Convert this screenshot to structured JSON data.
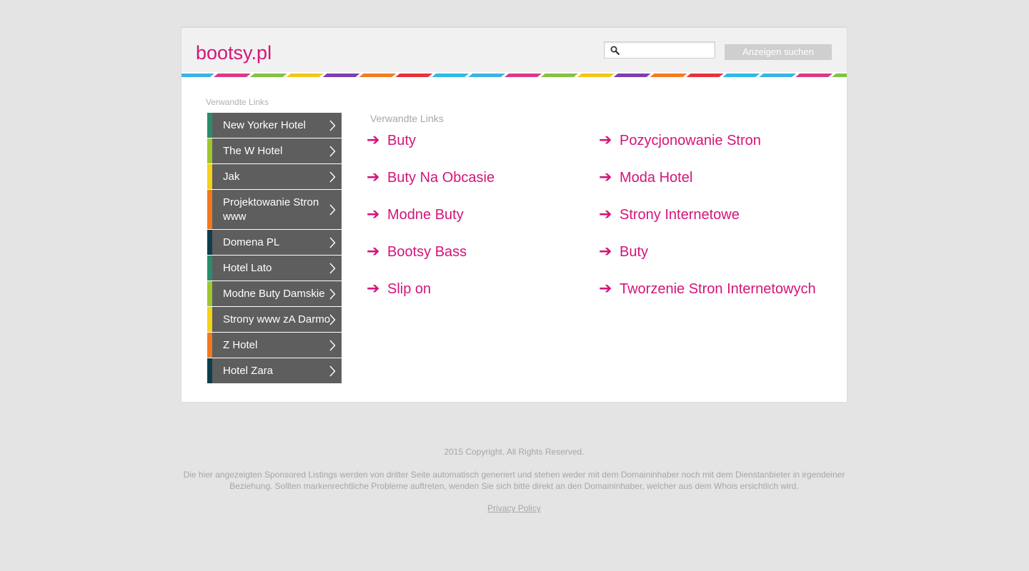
{
  "header": {
    "logo_text": "bootsy.pl",
    "search": {
      "value": "",
      "placeholder": "",
      "icon": "search-icon"
    },
    "search_button_label": "Anzeigen suchen",
    "stripe_colors": [
      "#39b4e2",
      "#d93a86",
      "#82c341",
      "#f4c51d",
      "#7d3fb0",
      "#f47c20",
      "#e5333e",
      "#2fbbe4"
    ]
  },
  "sidebar": {
    "heading": "Verwandte Links",
    "items": [
      {
        "label": "New Yorker Hotel",
        "accent": "#2a8c6c"
      },
      {
        "label": "The W Hotel",
        "accent": "#9ec72f"
      },
      {
        "label": "Jak",
        "accent": "#f2d21a"
      },
      {
        "label": "Projektowanie Stron www",
        "accent": "#f1791e"
      },
      {
        "label": "Domena PL",
        "accent": "#0f3d4c"
      },
      {
        "label": "Hotel Lato",
        "accent": "#2a8c6c"
      },
      {
        "label": "Modne Buty Damskie",
        "accent": "#9ec72f"
      },
      {
        "label": "Strony www zA Darmo",
        "accent": "#f2d21a"
      },
      {
        "label": "Z Hotel",
        "accent": "#f1791e"
      },
      {
        "label": "Hotel Zara",
        "accent": "#0f3d4c"
      }
    ]
  },
  "main": {
    "heading": "Verwandte Links",
    "arrow_glyph": "➔",
    "links": [
      {
        "label": "Buty"
      },
      {
        "label": "Pozycjonowanie Stron"
      },
      {
        "label": "Buty Na Obcasie"
      },
      {
        "label": "Moda Hotel"
      },
      {
        "label": "Modne Buty"
      },
      {
        "label": "Strony Internetowe"
      },
      {
        "label": "Bootsy Bass"
      },
      {
        "label": "Buty"
      },
      {
        "label": "Slip on"
      },
      {
        "label": "Tworzenie Stron Internetowych"
      }
    ]
  },
  "footer": {
    "copyright": "2015 Copyright. All Rights Reserved.",
    "disclaimer": "Die hier angezeigten Sponsored Listings werden von dritter Seite automatisch generiert und stehen weder mit dem Domaininhaber noch mit dem Dienstanbieter in irgendeiner Beziehung. Sollten markenrechtliche Probleme auftreten, wenden Sie sich bitte direkt an den Domaininhaber, welcher aus dem Whois ersichtlich wird.",
    "privacy_label": "Privacy Policy"
  },
  "colors": {
    "page_bg": "#e4e4e4",
    "accent_pink": "#d4147a",
    "menu_bg": "#5e5e5e",
    "muted_text": "#a6a6a6"
  }
}
